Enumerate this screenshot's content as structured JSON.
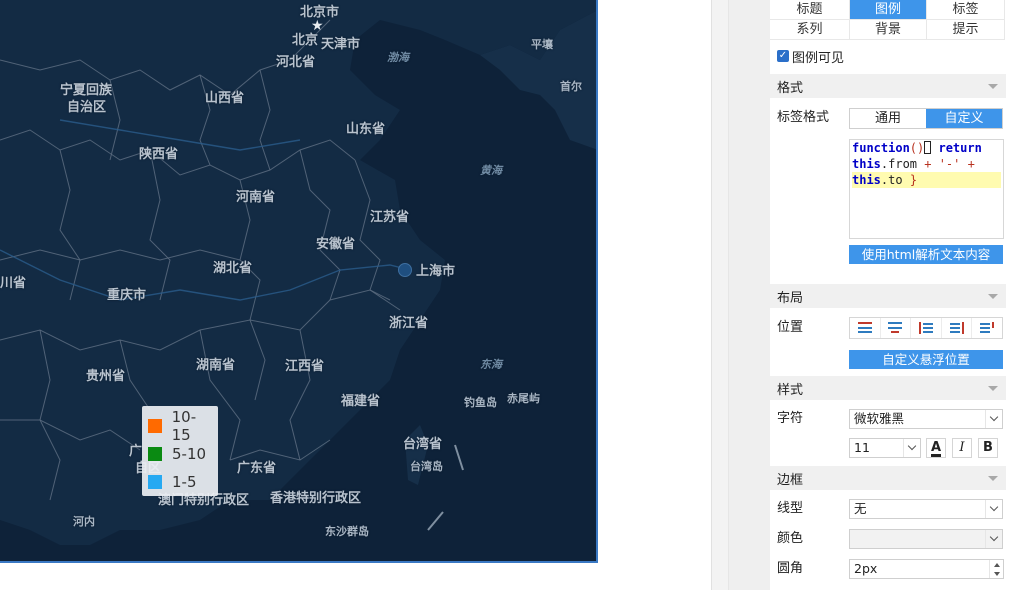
{
  "map": {
    "labels": {
      "beijing_city": "北京市",
      "beijing": "北京",
      "tianjin": "天津市",
      "hebei": "河北省",
      "bohai": "渤海",
      "pingrang": "平壤",
      "seoul": "首尔",
      "ningxia": "宁夏回族",
      "ningxia2": "自治区",
      "shanxi": "山西省",
      "shandong": "山东省",
      "shaanxi": "陕西省",
      "huanghai": "黄海",
      "henan": "河南省",
      "jiangsu": "江苏省",
      "anhui": "安徽省",
      "hubei": "湖北省",
      "shanghai": "上海市",
      "sichuan": "川省",
      "chongqing": "重庆市",
      "zhejiang": "浙江省",
      "hunan": "湖南省",
      "jiangxi": "江西省",
      "guizhou": "贵州省",
      "donghai": "东海",
      "fujian": "福建省",
      "diaoyu": "钓鱼岛",
      "chiwei": "赤尾屿",
      "taiwan_prov": "台湾省",
      "taiwan_island": "台湾岛",
      "guangxi_frag": "广",
      "guangxi_frag2": "自区",
      "guangdong": "广东省",
      "macau": "澳门特别行政区",
      "hongkong": "香港特别行政区",
      "hanoi": "河内",
      "dongsha": "东沙群岛"
    },
    "legend": [
      {
        "label": "10-15",
        "color": "#ff6a00"
      },
      {
        "label": "5-10",
        "color": "#0a8a12"
      },
      {
        "label": "1-5",
        "color": "#26a9f2"
      }
    ]
  },
  "panel": {
    "tabs_row1": [
      "标题",
      "图例",
      "标签"
    ],
    "tabs_row1_active": 1,
    "tabs_row2": [
      "系列",
      "背景",
      "提示"
    ],
    "legend_visible_label": "图例可见",
    "sections": {
      "format": "格式",
      "layout": "布局",
      "style": "样式",
      "border": "边框"
    },
    "label_format": {
      "label": "标签格式",
      "options": [
        "通用",
        "自定义"
      ],
      "active": 1,
      "code": {
        "l1_kw": "function",
        "l1_paren": "()",
        "l1_ret": "return",
        "l2_this": "this",
        "l2_prop": ".from",
        "l2_op": " + '-' +",
        "l3_this": "this",
        "l3_prop": ".to",
        "l3_brace": " }"
      },
      "html_button": "使用html解析文本内容"
    },
    "position": {
      "label": "位置",
      "custom_button": "自定义悬浮位置"
    },
    "font": {
      "label": "字符",
      "family": "微软雅黑",
      "size": "11",
      "color_btn": "A",
      "italic_btn": "I",
      "bold_btn": "B"
    },
    "border": {
      "line_label": "线型",
      "line_value": "无",
      "color_label": "颜色",
      "color_value": "",
      "radius_label": "圆角",
      "radius_value": "2px"
    }
  }
}
